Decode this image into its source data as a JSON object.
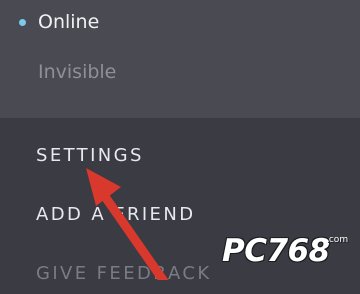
{
  "status_menu": {
    "items": [
      {
        "label": "Online",
        "dot_color": "#7dc8ec",
        "selected": true
      },
      {
        "label": "Invisible"
      }
    ]
  },
  "menu": {
    "settings": "SETTINGS",
    "add_friend": "ADD A FRIEND",
    "give_feedback": "GIVE FEEDBACK"
  },
  "annotation": {
    "arrow_color": "#d9382c",
    "icon": "arrow-pointer-icon"
  },
  "watermark": {
    "text": "PC768",
    "subtext": ".com"
  },
  "colors": {
    "panel_bg": "#494a52",
    "background": "#3a3b43",
    "text_primary": "#e8e9ee",
    "text_muted": "#8e8f98"
  }
}
